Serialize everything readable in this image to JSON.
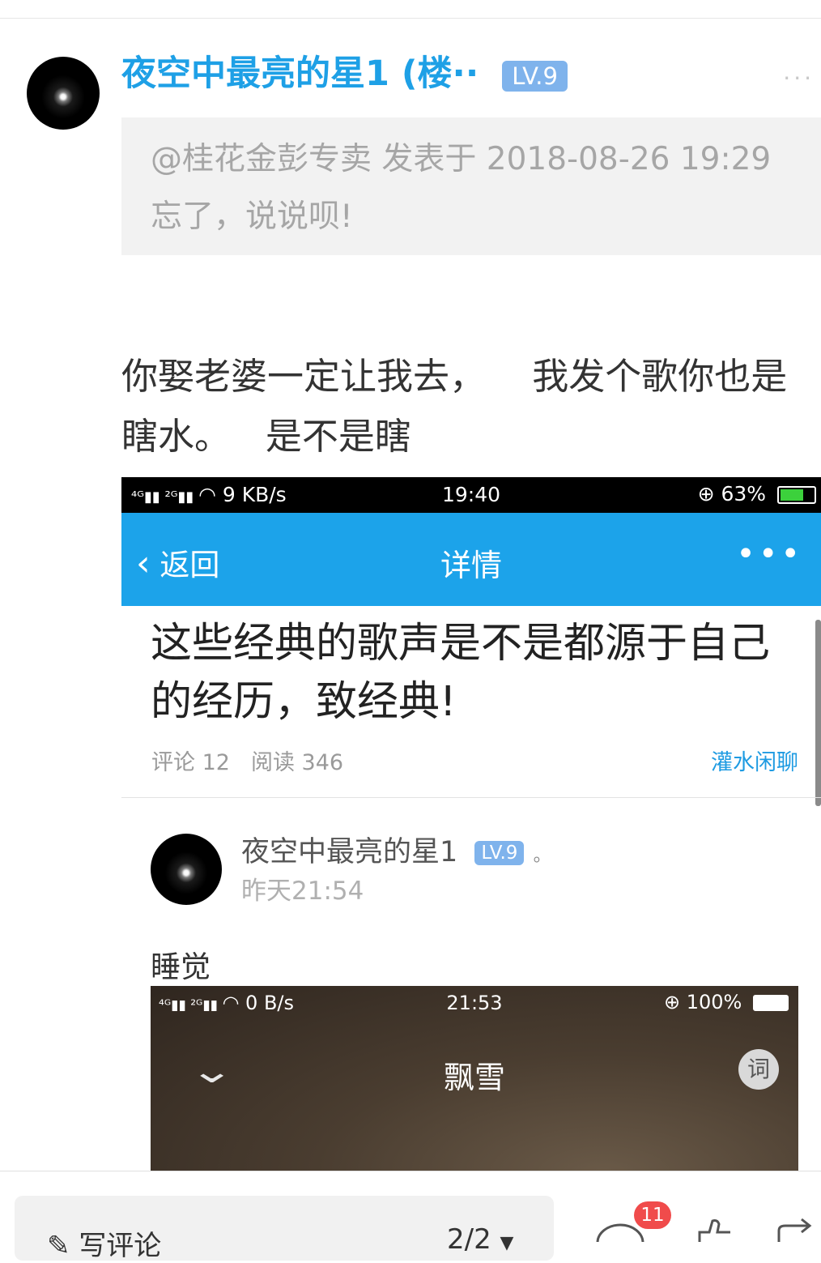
{
  "header": {
    "username": "夜空中最亮的星1 (楼··",
    "level": "LV.9",
    "more": "···"
  },
  "quote": {
    "line1": "@桂花金彭专卖 发表于 2018-08-26 19:29",
    "line2": "忘了，说说呗!"
  },
  "post": {
    "line1": "你娶老婆一定让我去，    我发个歌你也是",
    "line2": "瞎水。   是不是瞎"
  },
  "screenshot1": {
    "status_left": "9 KB/s",
    "status_time": "19:40",
    "status_battery": "63%",
    "battery_level": 0.63,
    "nav_back": "返回",
    "nav_title": "详情",
    "nav_more": "•••",
    "article_title": "这些经典的歌声是不是都源于自己的经历，致经典!",
    "comments": "评论 12",
    "reads": "阅读 346",
    "tag": "灌水闲聊",
    "reply_user": "夜空中最亮的星1",
    "reply_level": "LV.9",
    "reply_suffix": "。",
    "reply_time": "昨天21:54",
    "reply_text": "睡觉"
  },
  "screenshot2": {
    "status_left": "0 B/s",
    "status_time": "21:53",
    "status_battery": "100%",
    "song_title": "飘雪",
    "lyric_button": "词"
  },
  "bottom": {
    "comment_placeholder": "写评论",
    "page_indicator": "2/2",
    "badge_count": "11"
  },
  "colors": {
    "accent": "#1ea0e6",
    "nav_blue": "#1ca3ea",
    "level_badge": "#7fb3ec",
    "badge_red": "#f04b4b"
  }
}
